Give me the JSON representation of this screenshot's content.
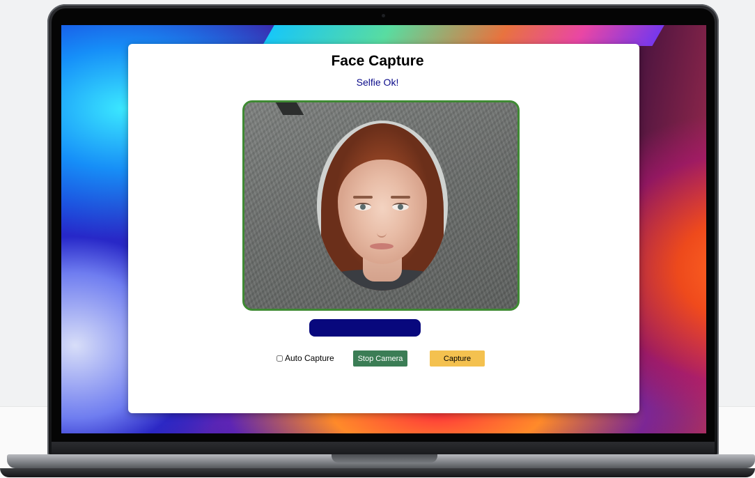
{
  "app": {
    "title": "Face Capture",
    "status": "Selfie Ok!"
  },
  "controls": {
    "auto_capture_label": "Auto Capture",
    "auto_capture_checked": false,
    "stop_camera_label": "Stop Camera",
    "capture_label": "Capture"
  },
  "colors": {
    "frame_border": "#3f8a33",
    "status_text": "#0b0b8a",
    "progress_bar": "#08087d",
    "stop_button": "#3b7d55",
    "capture_button": "#f4c14f"
  }
}
